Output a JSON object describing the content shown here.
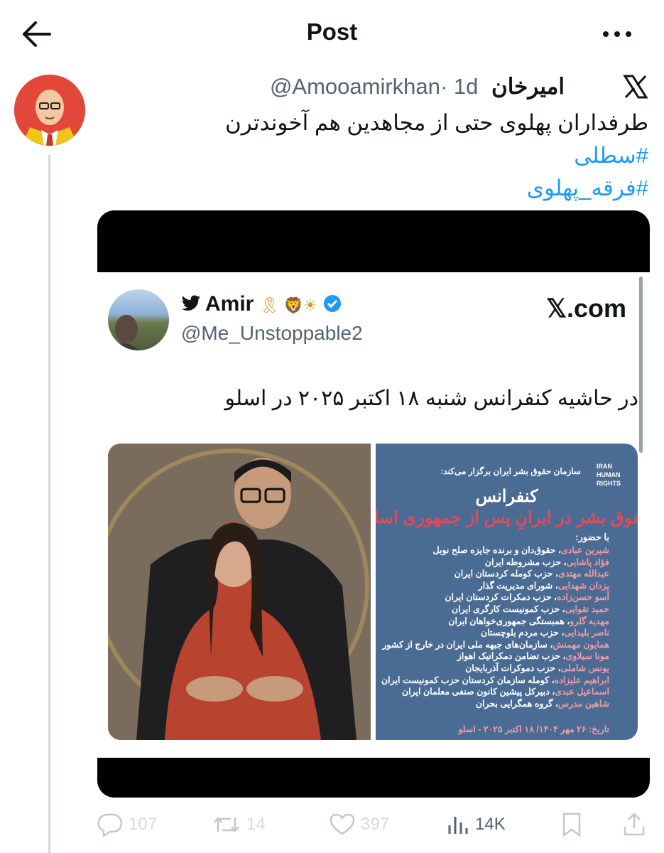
{
  "header": {
    "title": "Post"
  },
  "tweet": {
    "author_name": "امیرخان",
    "handle": "@Amooamirkhan",
    "time": "· 1d",
    "text": "طرفداران پهلوی حتی از مجاهدین هم آخوندترن",
    "hashtags": [
      "#سطلی",
      "#فرقه_پهلوی"
    ]
  },
  "embedded": {
    "name": "Amir",
    "badges": "🎗 🦁☀",
    "handle": "@Me_Unstoppable2",
    "source": "𝕏.com",
    "text": "در حاشیه کنفرانس شنبه ۱۸ اکتبر ۲۰۲۵ در اسلو",
    "poster": {
      "org": "IRAN HUMAN RIGHTS",
      "host": "سازمان حقوق بشر ایران برگزار می‌کند:",
      "conference": "کنفرانس",
      "subtitle": "حقوق بشر در ایرانِ پس از جمهوری اسلامی",
      "with": "با حضور:",
      "participants": [
        {
          "name": "شیرین عبادی",
          "role": "، حقوق‌دان و برنده جایزه صلح نوبل"
        },
        {
          "name": "فؤاد پاشایی",
          "role": "، حزب مشروطه ایران"
        },
        {
          "name": "عبدالله مهتدی",
          "role": "، حزب کومله کردستان ایران"
        },
        {
          "name": "یزدان شهدایی",
          "role": "، شورای مدیریت گذار"
        },
        {
          "name": "آسو حسن‌زاده",
          "role": "، حزب دمکرات کردستان ایران"
        },
        {
          "name": "حمید تقوایی",
          "role": "، حزب کمونیست کارگری ایران"
        },
        {
          "name": "مهدیه گلرو",
          "role": "، همبستگی جمهوری‌خواهان ایران"
        },
        {
          "name": "ناصر بلیدایی",
          "role": "، حزب مردم بلوچستان"
        },
        {
          "name": "همایون مهمنش",
          "role": "، سازمان‌های جبهه ملی ایران در خارج از کشور"
        },
        {
          "name": "مونا سیلاوی",
          "role": "، حزب تضامن دمکراتیک اهواز"
        },
        {
          "name": "یونس شاملی",
          "role": "، حزب دموکرات آذربایجان"
        },
        {
          "name": "ابراهیم علیزاده",
          "role": "، کومله سازمان کردستان حزب کمونیست ایران"
        },
        {
          "name": "اسماعیل عبدی",
          "role": "، دبیرکل پیشین کانون صنفی معلمان ایران"
        },
        {
          "name": "شاهین مدرس",
          "role": "، گروه همگرایی بحران"
        }
      ],
      "date": "تاریخ: ۲۶ مهر ۱۴۰۴/ ۱۸ اکتبر ۲۰۲۵ - اسلو"
    }
  },
  "stats": {
    "replies": "107",
    "reposts": "14",
    "likes": "397",
    "views": "14K"
  }
}
